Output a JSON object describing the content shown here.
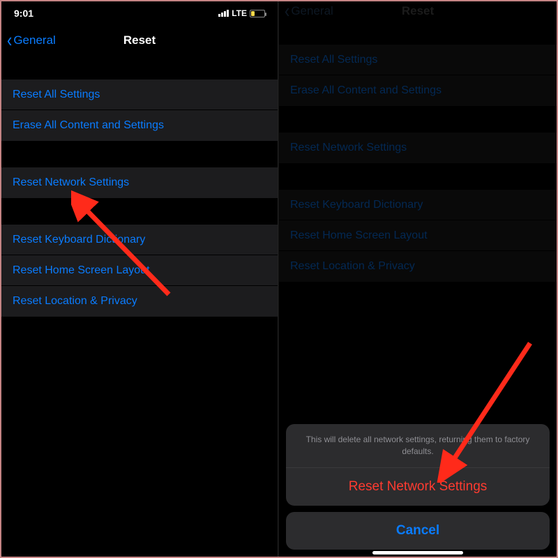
{
  "statusbar": {
    "time": "9:01",
    "carrier": "LTE"
  },
  "nav": {
    "back": "General",
    "title": "Reset"
  },
  "groups": {
    "g1": [
      "Reset All Settings",
      "Erase All Content and Settings"
    ],
    "g2": [
      "Reset Network Settings"
    ],
    "g3": [
      "Reset Keyboard Dictionary",
      "Reset Home Screen Layout",
      "Reset Location & Privacy"
    ]
  },
  "sheet": {
    "message": "This will delete all network settings, returning them to factory defaults.",
    "action": "Reset Network Settings",
    "cancel": "Cancel"
  }
}
